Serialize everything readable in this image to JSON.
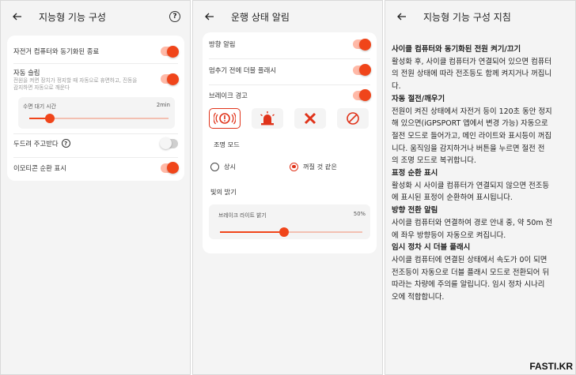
{
  "left_panel": {
    "title": "지능형 기능 구성",
    "sync_off_label": "자전거 컴퓨터와 동기화된 종료",
    "auto_sleep_label": "자동 슬립",
    "auto_sleep_desc_1": "전원을 켜면 장치가 정지할 때 자동으로 휴면하고, 진동을",
    "auto_sleep_desc_2": "감지하면 자동으로 깨운다",
    "sleep_time_label": "수면 대기 시간",
    "sleep_time_value": "2min",
    "sleep_time_fraction": 0.15,
    "knock_label": "두드려 주고받다",
    "emoji_label": "이모티콘 순환 표시"
  },
  "middle_panel": {
    "title": "운행 상태 알림",
    "turn_alert_label": "방향 알림",
    "flash_label": "멈추기 전에 더블 플래시",
    "brake_warning_label": "브레이크 경고",
    "light_mode_label": "조명 모드",
    "mode_always": "상시",
    "mode_blink": "꺼질 것 같은",
    "brightness_label": "빛의 밝기",
    "brake_light_label": "브레이크 라이트 밝기",
    "brake_light_value": "50%",
    "brake_light_fraction": 0.45
  },
  "right_panel": {
    "title": "지능형 기능 구성 지침",
    "sections": [
      {
        "heading": "사이클 컴퓨터와 동기화된 전원 켜기/끄기",
        "lines": [
          "활성화 후, 사이클 컴퓨터가 연결되어 있으면 컴퓨터",
          "의 전원 상태에 따라 전조등도 함께 켜지거나 꺼집니",
          "다."
        ]
      },
      {
        "heading": "자동 절전/깨우기",
        "lines": [
          "전원이 켜진 상태에서 자전거 등이 120초 동안 정지",
          "해 있으면(iGPSPORT 앱에서 변경 가능) 자동으로",
          "절전 모드로 들어가고, 메인 라이트와 표시등이 꺼집",
          "니다. 움직임을 감지하거나 버튼을 누르면 절전 전",
          "의 조명 모드로 복귀합니다."
        ]
      },
      {
        "heading": "표정 순환 표시",
        "lines": [
          "활성화 시 사이클 컴퓨터가 연결되지 않으면 전조등",
          "에 표시된 표정이 순환하여 표시됩니다."
        ]
      },
      {
        "heading": "방향 전환 알림",
        "lines": [
          "사이클 컴퓨터와 연결하여 경로 안내 중, 약 50m 전",
          "에 좌우 방향등이 자동으로 켜집니다."
        ]
      },
      {
        "heading": "임시 정차 시 더블 플래시",
        "lines": [
          "사이클 컴퓨터에 연결된 상태에서 속도가 0이 되면",
          "전조등이 자동으로 더블 플래시 모드로 전환되어 뒤",
          "따라는 차량에 주의를 알립니다. 임시 정차 시나리",
          "오에 적합합니다."
        ]
      }
    ]
  },
  "watermark": "FASTI.KR",
  "colors": {
    "accent": "#f0451a",
    "track": "#f3c0b2",
    "panel_bg": "#f4f4f4"
  }
}
